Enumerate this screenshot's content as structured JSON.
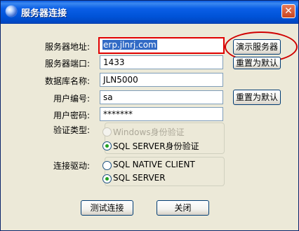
{
  "window": {
    "title": "服务器连接",
    "close_glyph": "✕"
  },
  "form": {
    "server_address": {
      "label": "服务器地址:",
      "value": "erp.jlnrj.com"
    },
    "server_port": {
      "label": "服务器端口:",
      "value": "1433"
    },
    "database_name": {
      "label": "数据库名称:",
      "value": "JLN5000"
    },
    "user_id": {
      "label": "用户编号:",
      "value": "sa"
    },
    "user_password": {
      "label": "用户密码:",
      "value": "*******"
    },
    "auth_type": {
      "label": "验证类型:",
      "options": [
        {
          "label": "Windows身份验证",
          "selected": false,
          "disabled": true
        },
        {
          "label": "SQL SERVER身份验证",
          "selected": true,
          "disabled": false
        }
      ]
    },
    "connection_driver": {
      "label": "连接驱动:",
      "options": [
        {
          "label": "SQL NATIVE CLIENT",
          "selected": false
        },
        {
          "label": "SQL SERVER",
          "selected": true
        }
      ]
    }
  },
  "buttons": {
    "demo_server": "演示服务器",
    "reset_default_1": "重置为默认",
    "reset_default_2": "重置为默认",
    "test_connection": "测试连接",
    "close": "关闭"
  },
  "colors": {
    "title_bar": "#0054e3",
    "annotation_red": "#e00000",
    "selection": "#316ac5"
  }
}
